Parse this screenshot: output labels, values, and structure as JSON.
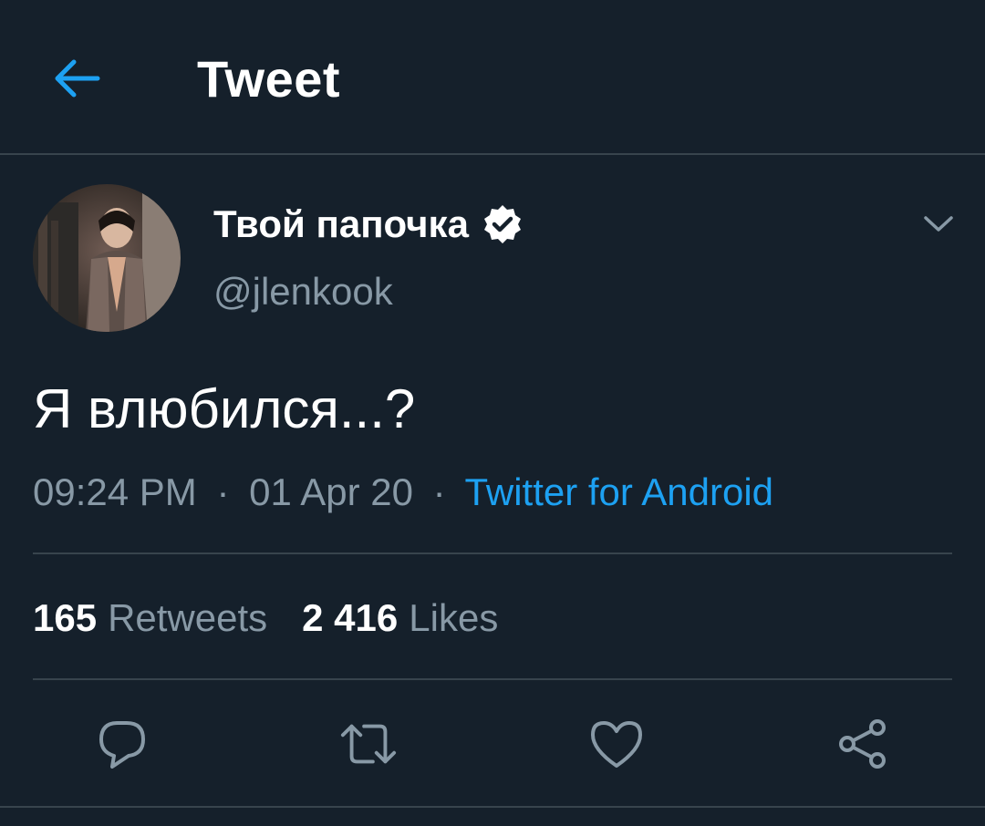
{
  "header": {
    "title": "Tweet",
    "back_icon": "arrow-left-icon"
  },
  "author": {
    "display_name": "Твой папочка",
    "handle": "@jlenkook",
    "verified": true
  },
  "tweet": {
    "text": "Я влюбился...?",
    "time": "09:24 PM",
    "separator": "·",
    "date": "01 Apr 20",
    "source": "Twitter for Android"
  },
  "stats": {
    "retweets_count": "165",
    "retweets_label": "Retweets",
    "likes_count": "2 416",
    "likes_label": "Likes"
  },
  "actions": [
    "reply-icon",
    "retweet-icon",
    "like-icon",
    "share-icon"
  ],
  "colors": {
    "background": "#15202b",
    "accent": "#1da1f2",
    "secondary_text": "#8899a6",
    "divider": "#38444d"
  }
}
